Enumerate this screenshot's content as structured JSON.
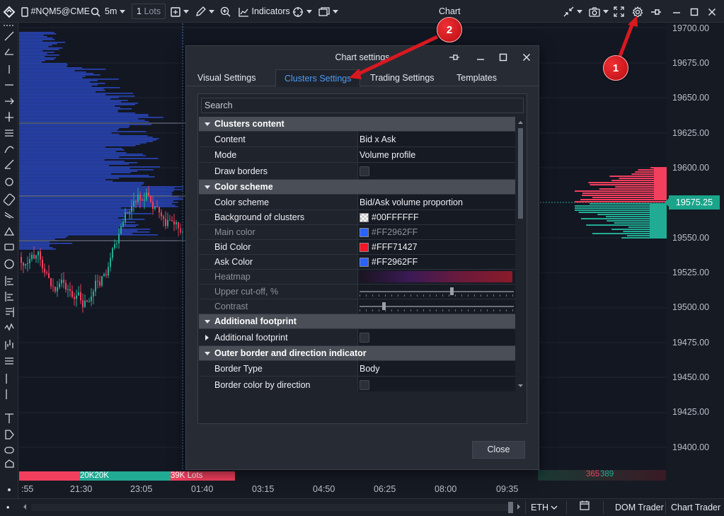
{
  "toolbar": {
    "symbol": "#NQM5@CME",
    "timeframe": "5m",
    "lots_value": "1",
    "lots_unit": "Lots",
    "indicators_label": "Indicators",
    "window_title": "Chart"
  },
  "price_axis": {
    "ticks": [
      "19700.00",
      "19675.00",
      "19650.00",
      "19625.00",
      "19600.00",
      "19575.25",
      "19550.00",
      "19525.00",
      "19500.00",
      "19475.00",
      "19450.00",
      "19425.00",
      "19400.00"
    ],
    "current_price": "19575.25"
  },
  "time_axis": {
    "ticks": [
      ":55",
      "21:30",
      "23:05",
      "01:40",
      "03:15",
      "04:50",
      "06:25",
      "08:00",
      "09:35"
    ]
  },
  "volume_strip": {
    "left_text": "20K20K",
    "mid_text": "39K Lots",
    "right_red": "365",
    "right_green": "389"
  },
  "statusbar": {
    "account": "ETH",
    "dom_trader": "DOM Trader",
    "chart_trader": "Chart Trader"
  },
  "dialog": {
    "title": "Chart settings",
    "tabs": [
      "Visual Settings",
      "Clusters Settings",
      "Trading Settings",
      "Templates"
    ],
    "active_tab": 1,
    "search_placeholder": "Search",
    "close_label": "Close",
    "rows": [
      {
        "type": "section",
        "label": "Clusters content"
      },
      {
        "type": "text",
        "label": "Content",
        "value": "Bid x Ask"
      },
      {
        "type": "text",
        "label": "Mode",
        "value": "Volume profile"
      },
      {
        "type": "check",
        "label": "Draw borders"
      },
      {
        "type": "section",
        "label": "Color scheme"
      },
      {
        "type": "text",
        "label": "Color scheme",
        "value": "Bid/Ask volume proportion"
      },
      {
        "type": "color",
        "label": "Background of clusters",
        "value": "#00FFFFFF",
        "swatch": "transparent"
      },
      {
        "type": "color",
        "label": "Main color",
        "value": "#FF2962FF",
        "swatch": "#2962FF",
        "dim": true
      },
      {
        "type": "color",
        "label": "Bid Color",
        "value": "#FFF71427",
        "swatch": "#F71427"
      },
      {
        "type": "color",
        "label": "Ask Color",
        "value": "#FF2962FF",
        "swatch": "#2962FF"
      },
      {
        "type": "heat",
        "label": "Heatmap",
        "dim": true
      },
      {
        "type": "slider",
        "label": "Upper cut-off, %",
        "pos": 0.6,
        "dim": true
      },
      {
        "type": "slider",
        "label": "Contrast",
        "pos": 0.15,
        "dim": true
      },
      {
        "type": "section",
        "label": "Additional footprint"
      },
      {
        "type": "expand-check",
        "label": "Additional footprint"
      },
      {
        "type": "section",
        "label": "Outer border and direction indicator"
      },
      {
        "type": "text",
        "label": "Border Type",
        "value": "Body"
      },
      {
        "type": "check",
        "label": "Border color by direction"
      }
    ]
  },
  "callouts": [
    "1",
    "2"
  ],
  "colors": {
    "bull": "#22ab94",
    "bear": "#f23f5e",
    "profile": "#2e4fd6",
    "accent": "#4a9cf5",
    "callout": "#d71920"
  }
}
